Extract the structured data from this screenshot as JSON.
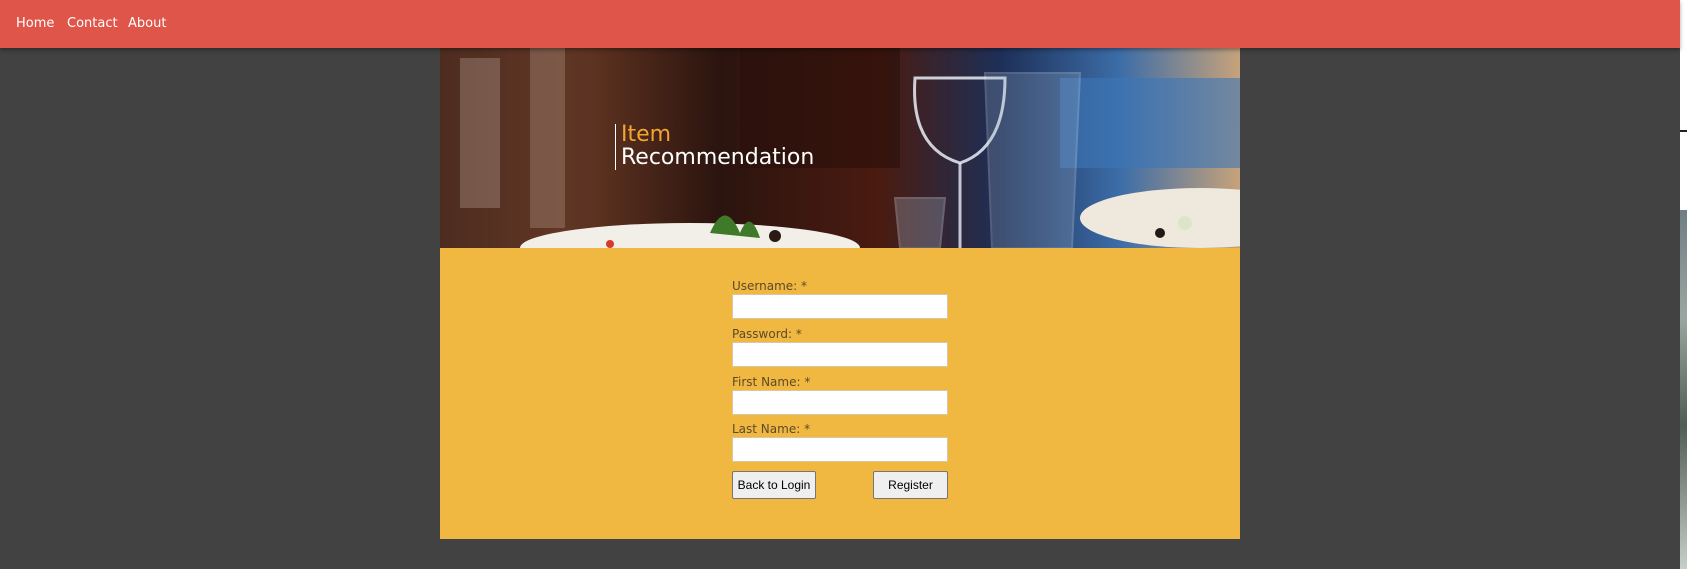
{
  "nav": {
    "items": [
      "Home",
      "Contact",
      "About"
    ]
  },
  "hero": {
    "title_line1": "Item",
    "title_line2": "Recommendation",
    "title_accent_color": "#f2a530"
  },
  "form": {
    "fields": [
      {
        "label": "Username: *",
        "value": ""
      },
      {
        "label": "Password: *",
        "value": ""
      },
      {
        "label": "First Name: *",
        "value": ""
      },
      {
        "label": "Last Name: *",
        "value": ""
      }
    ],
    "back_button": "Back to Login",
    "register_button": "Register"
  },
  "colors": {
    "navbar": "#e0554a",
    "background": "#424242",
    "form_panel": "#f1b841"
  }
}
